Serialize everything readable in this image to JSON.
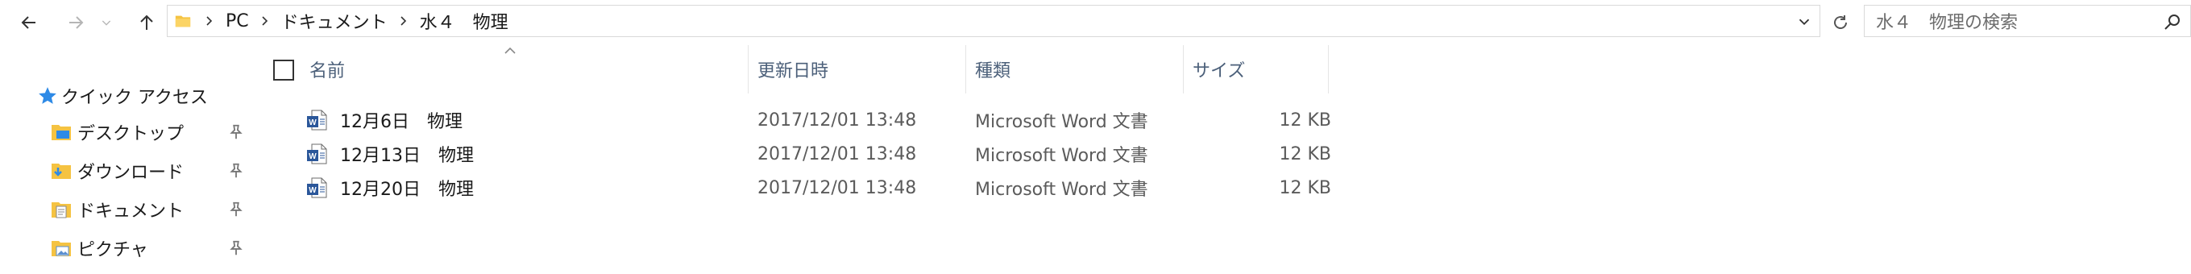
{
  "address_bar": {
    "breadcrumbs": [
      "PC",
      "ドキュメント",
      "水４　物理"
    ]
  },
  "search": {
    "placeholder": "水４　物理の検索"
  },
  "nav_pane": {
    "quick_access_label": "クイック アクセス",
    "items": [
      {
        "label": "デスクトップ",
        "icon": "desktop-folder-icon"
      },
      {
        "label": "ダウンロード",
        "icon": "downloads-folder-icon"
      },
      {
        "label": "ドキュメント",
        "icon": "documents-folder-icon"
      },
      {
        "label": "ピクチャ",
        "icon": "pictures-folder-icon"
      }
    ]
  },
  "file_list": {
    "columns": {
      "name": "名前",
      "modified": "更新日時",
      "type": "種類",
      "size": "サイズ"
    },
    "rows": [
      {
        "name": "12月6日　物理",
        "modified": "2017/12/01 13:48",
        "type": "Microsoft Word 文書",
        "size": "12 KB"
      },
      {
        "name": "12月13日　物理",
        "modified": "2017/12/01 13:48",
        "type": "Microsoft Word 文書",
        "size": "12 KB"
      },
      {
        "name": "12月20日　物理",
        "modified": "2017/12/01 13:48",
        "type": "Microsoft Word 文書",
        "size": "12 KB"
      }
    ]
  },
  "colors": {
    "accent": "#1e70cd",
    "folder": "#f5c342",
    "word": "#2b579a",
    "header_text": "#4c607a"
  }
}
